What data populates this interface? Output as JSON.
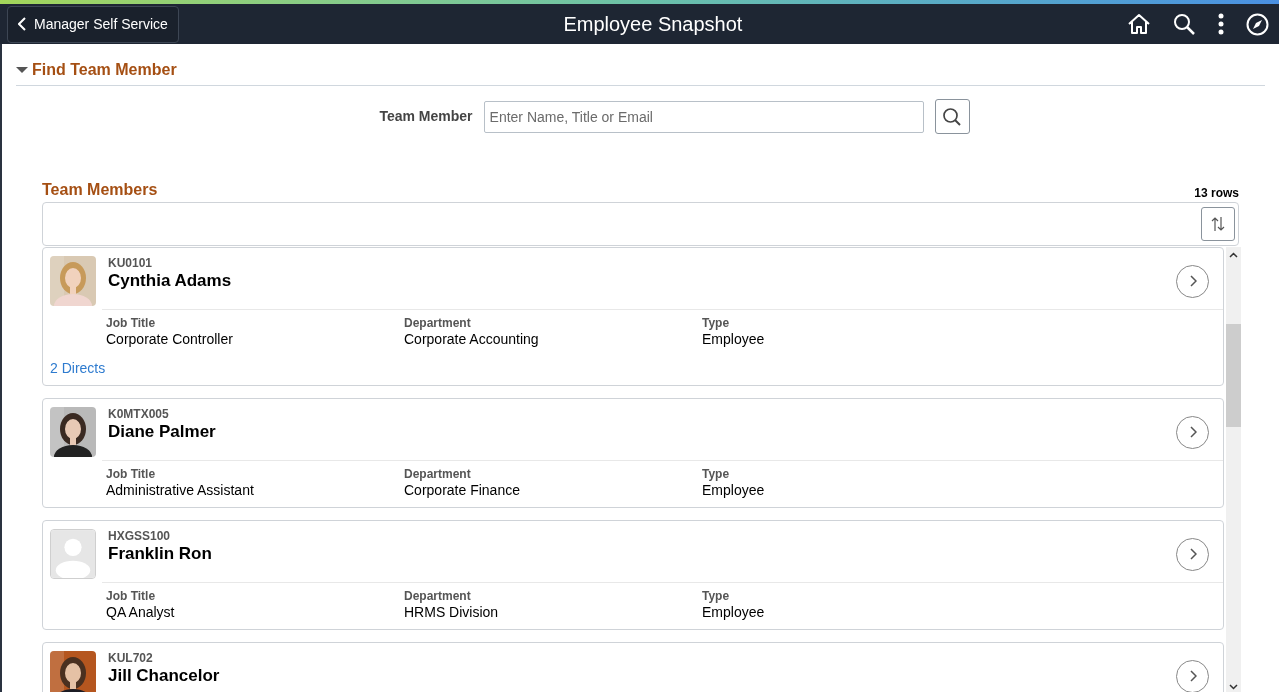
{
  "header": {
    "back_button": "Manager Self Service",
    "title": "Employee Snapshot"
  },
  "find_section": {
    "title": "Find Team Member",
    "expanded": true,
    "field_label": "Team Member",
    "placeholder": "Enter Name, Title or Email"
  },
  "team_members": {
    "title": "Team Members",
    "row_count": "13 rows",
    "rows": [
      {
        "id": "KU0101",
        "name": "Cynthia Adams",
        "avatar": {
          "kind": "picture"
        },
        "fields": [
          {
            "label": "Job Title",
            "value": "Corporate Controller"
          },
          {
            "label": "Department",
            "value": "Corporate Accounting"
          },
          {
            "label": "Type",
            "value": "Employee"
          }
        ],
        "link": "2 Directs"
      },
      {
        "id": "K0MTX005",
        "name": "Diane Palmer",
        "avatar": {
          "kind": "picture"
        },
        "fields": [
          {
            "label": "Job Title",
            "value": "Administrative Assistant"
          },
          {
            "label": "Department",
            "value": "Corporate Finance"
          },
          {
            "label": "Type",
            "value": "Employee"
          }
        ]
      },
      {
        "id": "HXGSS100",
        "name": "Franklin Ron",
        "avatar": {
          "kind": "placeholder"
        },
        "fields": [
          {
            "label": "Job Title",
            "value": "QA Analyst"
          },
          {
            "label": "Department",
            "value": "HRMS Division"
          },
          {
            "label": "Type",
            "value": "Employee"
          }
        ]
      },
      {
        "id": "KUL702",
        "name": "Jill Chancelor",
        "avatar": {
          "kind": "picture"
        }
      }
    ]
  }
}
